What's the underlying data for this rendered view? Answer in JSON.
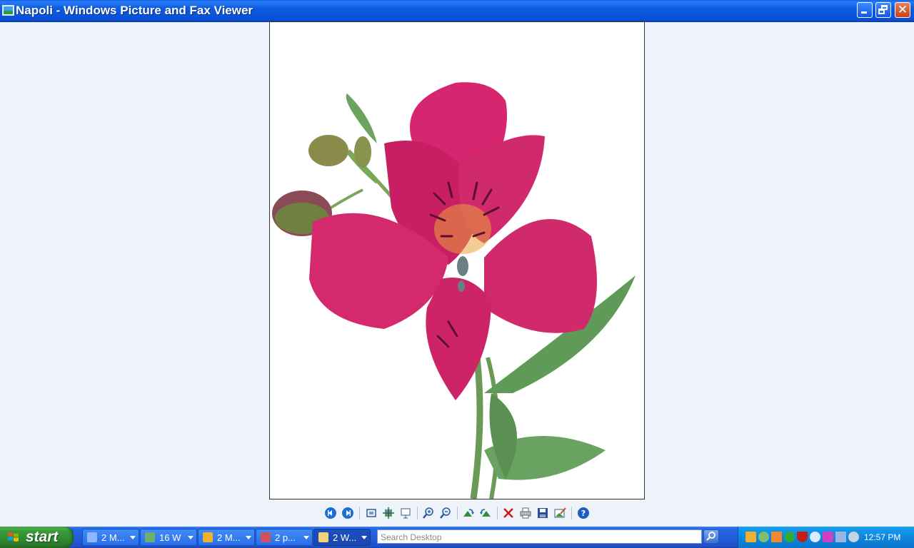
{
  "window": {
    "title": "Napoli - Windows Picture and Fax Viewer",
    "icon": "picture-viewer-icon"
  },
  "toolbar": {
    "buttons": [
      {
        "name": "previous-image",
        "icon": "previous-image-icon"
      },
      {
        "name": "next-image",
        "icon": "next-image-icon"
      },
      {
        "name": "best-fit",
        "icon": "best-fit-icon"
      },
      {
        "name": "actual-size",
        "icon": "actual-size-icon"
      },
      {
        "name": "slide-show",
        "icon": "slide-show-icon"
      },
      {
        "name": "zoom-in",
        "icon": "zoom-in-icon"
      },
      {
        "name": "zoom-out",
        "icon": "zoom-out-icon"
      },
      {
        "name": "rotate-clockwise",
        "icon": "rotate-clockwise-icon"
      },
      {
        "name": "rotate-counterclockwise",
        "icon": "rotate-counterclockwise-icon"
      },
      {
        "name": "delete",
        "icon": "delete-icon"
      },
      {
        "name": "print",
        "icon": "print-icon"
      },
      {
        "name": "copy-to",
        "icon": "save-icon"
      },
      {
        "name": "edit",
        "icon": "edit-image-icon"
      },
      {
        "name": "help",
        "icon": "help-icon"
      }
    ]
  },
  "taskbar": {
    "start_label": "start",
    "buttons": [
      {
        "label": "2 M...",
        "icon": "search-window-icon",
        "color": "#8fb6ff"
      },
      {
        "label": "16 W",
        "icon": "photo-icon",
        "color": "#6cb06c"
      },
      {
        "label": "2 M...",
        "icon": "outlook-icon",
        "color": "#f0b030"
      },
      {
        "label": "2 p...",
        "icon": "picture-viewer-icon",
        "color": "#d05060"
      },
      {
        "label": "2 W...",
        "icon": "folder-icon",
        "color": "#f2d27a"
      }
    ],
    "search": {
      "placeholder": "Search Desktop"
    },
    "tray_icons": [
      "outlook-icon",
      "network-user-icon",
      "calendar-icon",
      "refresh-icon",
      "antivirus-shield-icon",
      "search-icon",
      "messenger-icon",
      "network-icon",
      "volume-icon"
    ],
    "clock": "12:57 PM"
  },
  "colors": {
    "titlebar": "#0b5ae0",
    "taskbar": "#245ddb",
    "start": "#3a9b3a",
    "tray": "#0e86dc",
    "petal": "#d6266f",
    "leaf": "#5f9a58"
  }
}
